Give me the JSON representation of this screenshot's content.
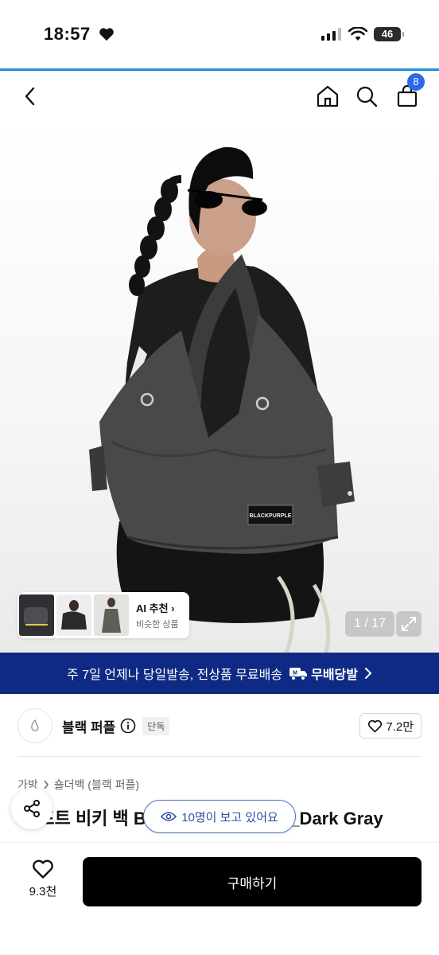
{
  "status_bar": {
    "time": "18:57",
    "battery": "46"
  },
  "header": {
    "cart_count": "8"
  },
  "gallery": {
    "ai_title": "AI 추천",
    "ai_subtitle": "비슷한 상품",
    "counter": "1 / 17",
    "badge_text": "BLACKPURPLE"
  },
  "shipping_banner": {
    "text": "주 7일 언제나 당일발송, 전상품 무료배송",
    "brand": "무배당발"
  },
  "brand": {
    "name": "블랙 퍼플",
    "tag": "단독",
    "likes": "7.2만"
  },
  "breadcrumb": [
    "가방",
    "숄더백 (블랙 퍼플)"
  ],
  "product": {
    "title": "빅 포트 비키 백 Big Port Vicky Bag_Dark Gray"
  },
  "viewers_pill": {
    "text": "10명이 보고 있어요"
  },
  "bottom_bar": {
    "wish_count": "9.3천",
    "buy_label": "구매하기"
  },
  "colors": {
    "accent_blue": "#2c6be8",
    "banner_navy": "#0e2a84",
    "status_rule": "#1d8fdc"
  }
}
